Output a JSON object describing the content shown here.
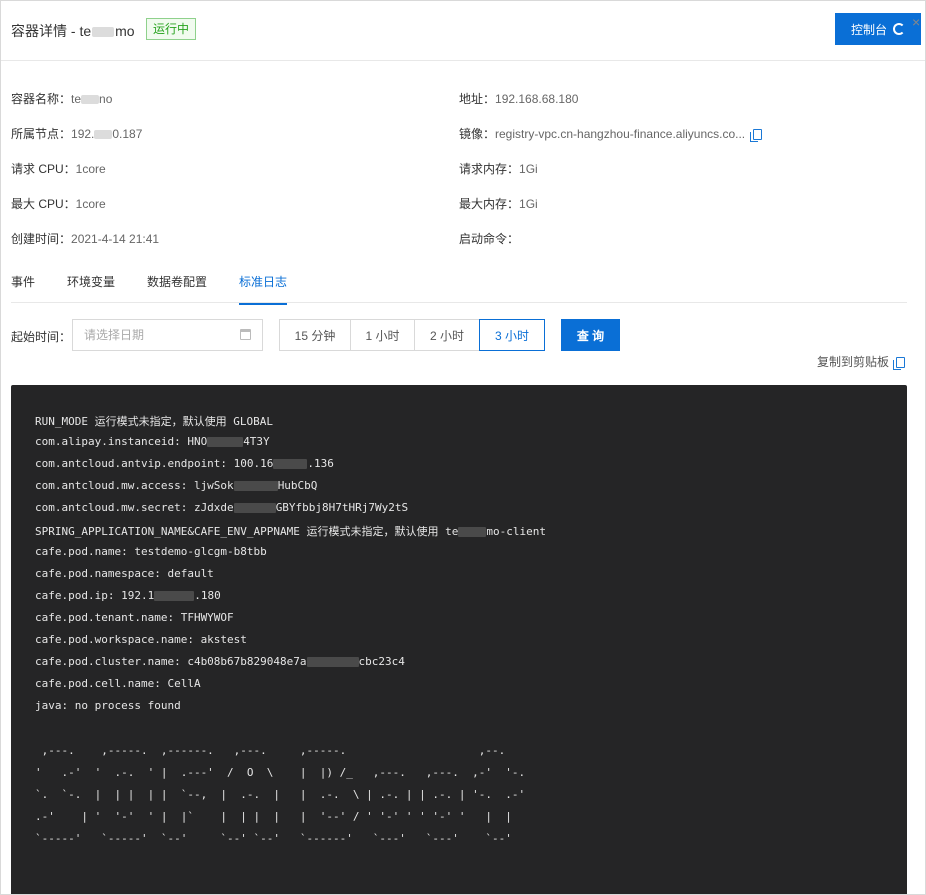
{
  "header": {
    "title_prefix": "容器详情 - te",
    "title_suffix": "mo",
    "status": "运行中",
    "console_label": "控制台",
    "close_glyph": "×"
  },
  "details": {
    "name_label": "容器名称：",
    "name_prefix": "te",
    "name_suffix": "no",
    "address_label": "地址：",
    "address_value": "192.168.68.180",
    "node_label": "所属节点：",
    "node_prefix": "192.",
    "node_suffix": "0.187",
    "image_label": "镜像：",
    "image_value": "registry-vpc.cn-hangzhou-finance.aliyuncs.co...",
    "req_cpu_label": "请求 CPU：",
    "req_cpu_value": "1core",
    "req_mem_label": "请求内存：",
    "req_mem_value": "1Gi",
    "max_cpu_label": "最大 CPU：",
    "max_cpu_value": "1core",
    "max_mem_label": "最大内存：",
    "max_mem_value": "1Gi",
    "created_label": "创建时间：",
    "created_value": "2021-4-14 21:41",
    "cmd_label": "启动命令：",
    "cmd_value": ""
  },
  "tabs": {
    "events": "事件",
    "env": "环境变量",
    "volumes": "数据卷配置",
    "stdout": "标准日志"
  },
  "filter": {
    "start_label": "起始时间：",
    "date_placeholder": "请选择日期",
    "range_15m": "15 分钟",
    "range_1h": "1 小时",
    "range_2h": "2 小时",
    "range_3h": "3 小时",
    "query_label": "查 询",
    "copy_label": "复制到剪贴板"
  },
  "log": {
    "l1": "RUN_MODE 运行模式未指定，默认使用 GLOBAL",
    "l2a": "com.alipay.instanceid: HNO",
    "l2b": "4T3Y",
    "l3a": "com.antcloud.antvip.endpoint: 100.16",
    "l3b": ".136",
    "l4a": "com.antcloud.mw.access: ljwSok",
    "l4b": "HubCbQ",
    "l5a": "com.antcloud.mw.secret: zJdxde",
    "l5b": "GBYfbbj8H7tHRj7Wy2tS",
    "l6a": "SPRING_APPLICATION_NAME&CAFE_ENV_APPNAME 运行模式未指定，默认使用 te",
    "l6b": "mo-client",
    "l7": "cafe.pod.name: testdemo-glcgm-b8tbb",
    "l8": "cafe.pod.namespace: default",
    "l9a": "cafe.pod.ip: 192.1",
    "l9b": ".180",
    "l10": "cafe.pod.tenant.name: TFHWYWOF",
    "l11": "cafe.pod.workspace.name: akstest",
    "l12a": "cafe.pod.cluster.name: c4b08b67b829048e7a",
    "l12b": "cbc23c4",
    "l13": "cafe.pod.cell.name: CellA",
    "l14": "java: no process found",
    "ascii": " ,---.    ,-----.  ,------.   ,---.     ,-----.                    ,--.\n'   .-'  '  .-.  ' |  .---'  /  O  \\    |  |) /_   ,---.   ,---.  ,-'  '-.\n`.  `-.  |  | |  | |  `--,  |  .-.  |   |  .-.  \\ | .-. | | .-. | '-.  .-'\n.-'    | '  '-'  ' |  |`    |  | |  |   |  '--' / ' '-' ' ' '-' '   |  |\n`-----'   `-----'  `--'     `--' `--'   `------'   `---'   `---'    `--'"
  }
}
